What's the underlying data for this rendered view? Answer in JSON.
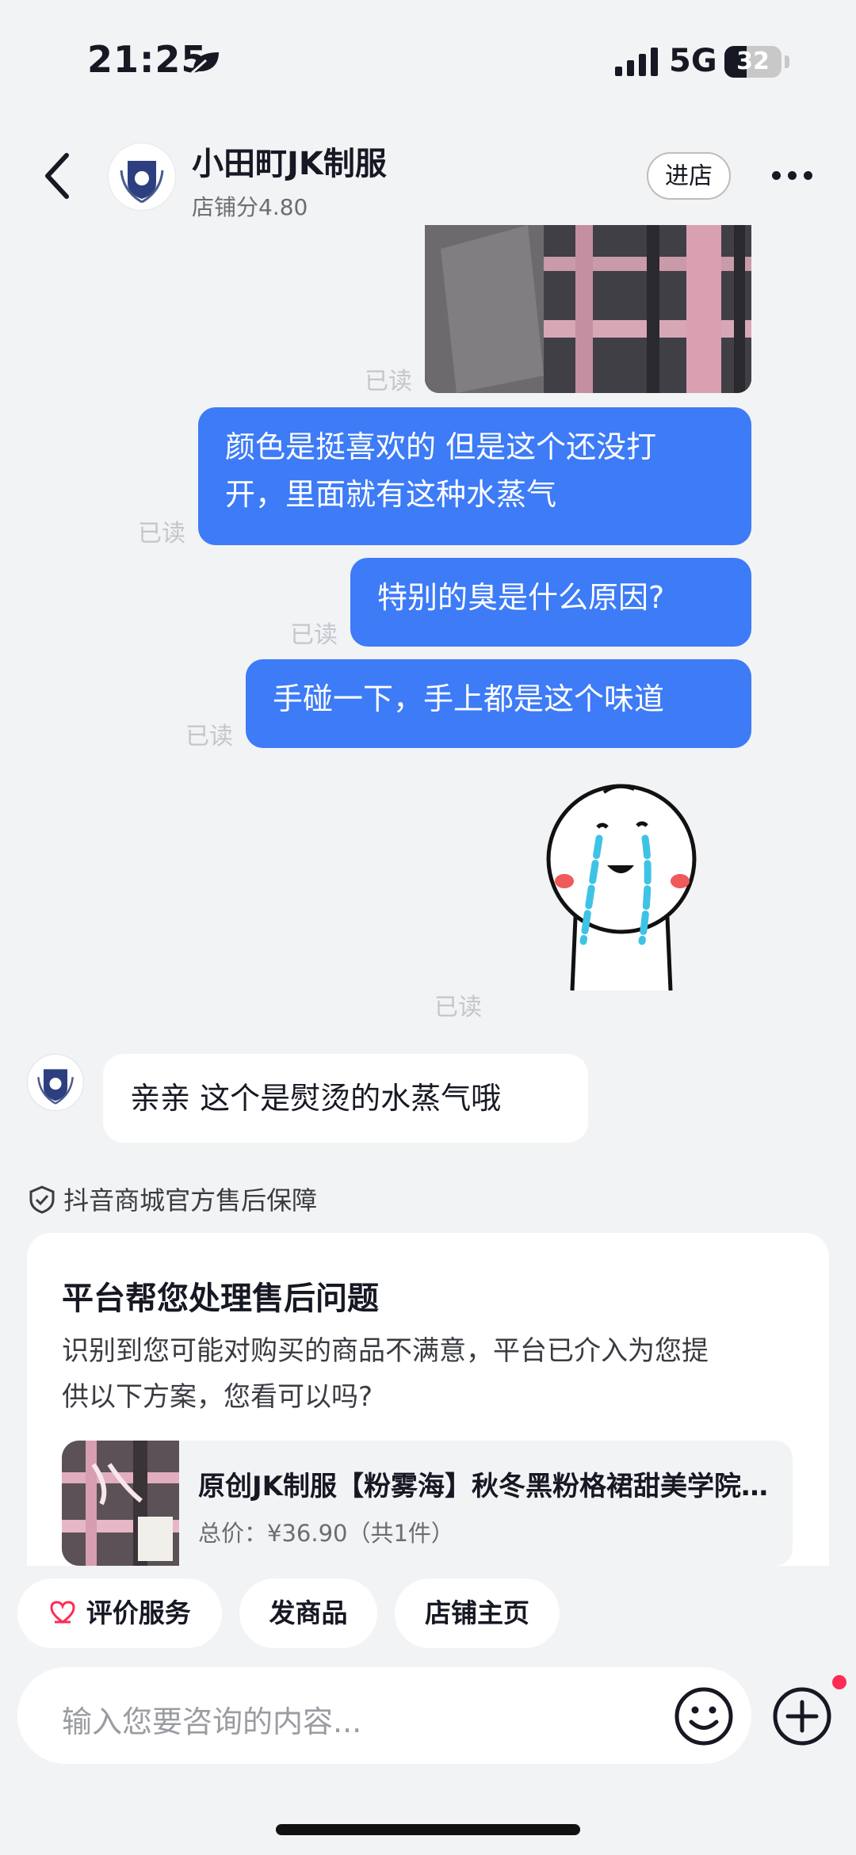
{
  "status_bar": {
    "time": "21:25",
    "network": "5G",
    "battery": "32"
  },
  "header": {
    "shop_name": "小田町JK制服",
    "shop_score": "店铺分4.80",
    "enter_shop": "进店"
  },
  "messages": [
    {
      "from": "me",
      "type": "image",
      "read": "已读"
    },
    {
      "from": "me",
      "type": "text",
      "line1": "颜色是挺喜欢的 但是这个还没打",
      "line2": "开，里面就有这种水蒸气",
      "read": "已读"
    },
    {
      "from": "me",
      "type": "text",
      "text": "特别的臭是什么原因?",
      "read": "已读"
    },
    {
      "from": "me",
      "type": "text",
      "text": "手碰一下，手上都是这个味道",
      "read": "已读"
    },
    {
      "from": "me",
      "type": "sticker",
      "read": "已读"
    },
    {
      "from": "shop",
      "type": "text",
      "text": "亲亲 这个是熨烫的水蒸气哦"
    }
  ],
  "guarantee": "抖音商城官方售后保障",
  "aftersale_card": {
    "title": "平台帮您处理售后问题",
    "desc_line1": "识别到您可能对购买的商品不满意，平台已介入为您提",
    "desc_line2": "供以下方案，您看可以吗?",
    "product_name": "原创JK制服【粉雾海】秋冬黑粉格裙甜美学院风百褶裙",
    "product_price": "总价：¥36.90（共1件）"
  },
  "quick_actions": [
    "评价服务",
    "发商品",
    "店铺主页"
  ],
  "input": {
    "placeholder": "输入您要咨询的内容..."
  },
  "colors": {
    "bubble": "#3d7bf7",
    "background": "#f2f3f5",
    "accent": "#fe2c55"
  }
}
